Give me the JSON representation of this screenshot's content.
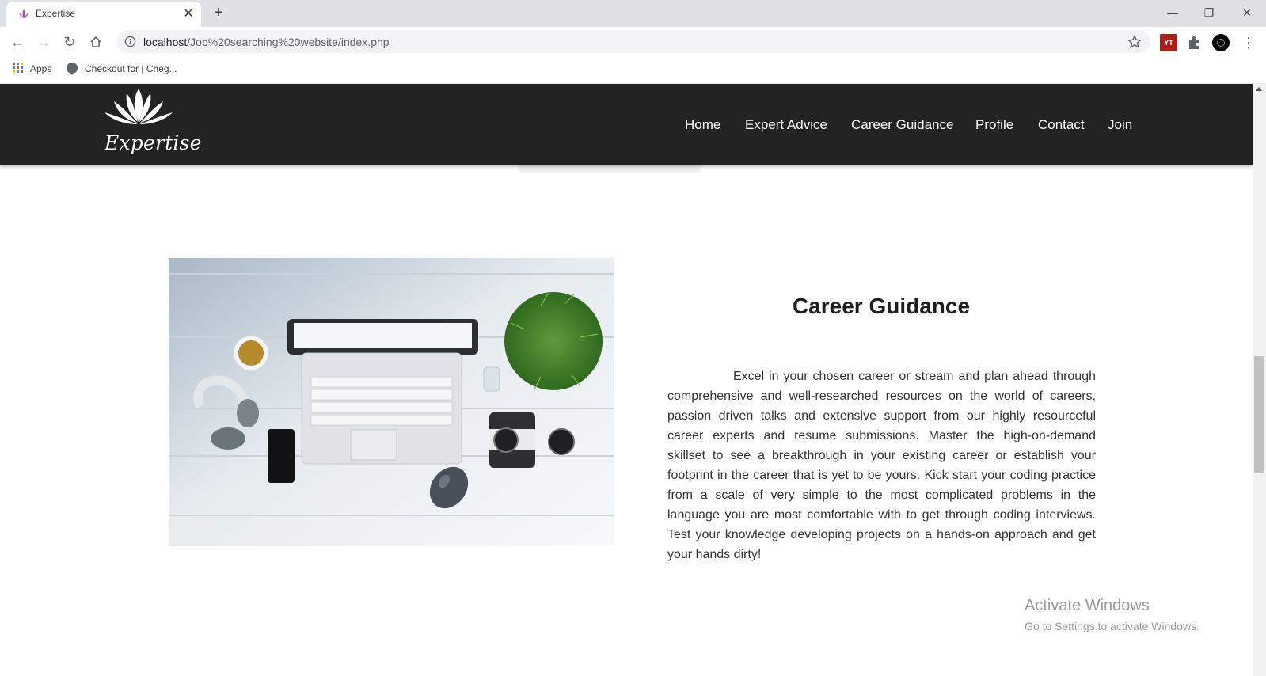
{
  "browser": {
    "tab_title": "Expertise",
    "url_host": "localhost",
    "url_path": "/Job%20searching%20website/index.php",
    "bookmarks": [
      {
        "label": "Apps"
      },
      {
        "label": "Checkout for | Cheg..."
      }
    ],
    "extensions": [
      {
        "icon": "youtube-extension-icon",
        "label": "YT"
      },
      {
        "icon": "puzzle-icon"
      },
      {
        "icon": "profile-avatar-icon"
      }
    ]
  },
  "site": {
    "logo_text": "Expertise",
    "nav": [
      {
        "label": "Home"
      },
      {
        "label": "Expert Advice"
      },
      {
        "label": "Career Guidance"
      },
      {
        "label": "Profile"
      },
      {
        "label": "Contact"
      },
      {
        "label": "Join"
      }
    ]
  },
  "section": {
    "title": "Career Guidance",
    "body": "Excel in your chosen career or stream and plan ahead through comprehensive and well-researched resources on the world of careers, passion driven talks and extensive support from our highly resourceful career experts and resume submissions. Master the high-on-demand skillset to see a breakthrough in your existing career or establish your footprint in the career that is yet to be yours. Kick start your coding practice from a scale of very simple to the most complicated problems in the language you are most comfortable with to get through coding interviews. Test your knowledge developing projects on a hands-on approach and get your hands dirty!"
  },
  "watermark": {
    "title": "Activate Windows",
    "subtitle": "Go to Settings to activate Windows."
  },
  "colors": {
    "nav_bg": "#232323",
    "tab_strip": "#dee1e6"
  }
}
